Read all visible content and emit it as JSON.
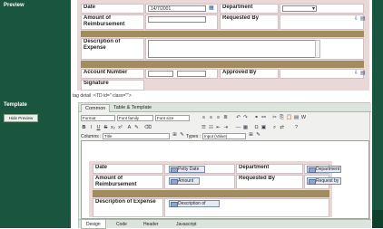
{
  "sidebar": {
    "preview_label": "Preview",
    "template_label": "Template",
    "hide_preview_button": "Hide Preview"
  },
  "preview_form": {
    "date_label": "Date",
    "date_value": "14/7/2001",
    "department_label": "Department",
    "amount_label": "Amount of Reimbursement",
    "requested_by_label": "Requested By",
    "description_label": "Description of Expense",
    "account_number_label": "Account Number",
    "approved_by_label": "Approved By",
    "signature_label": "Signature"
  },
  "tag_detail": "tag detail :<TD id=\" class=\"\">",
  "editor": {
    "tabs": [
      "Common",
      "Table & Template"
    ],
    "format_dropdown": "Format",
    "font_family_dropdown": "Font family",
    "font_size_dropdown": "Font size",
    "columns_label": "Columns :",
    "columns_value": "Title",
    "types_label": "Types :",
    "types_value": "Input (Value)"
  },
  "template_form": {
    "date_label": "Date",
    "date_field": "Petty Date",
    "department_label": "Department",
    "department_field": "Department",
    "amount_label": "Amount of Reimbursement",
    "amount_field": "Amount",
    "requested_by_label": "Requested By",
    "requested_by_field": "Request by",
    "description_label": "Description of Expense",
    "description_field": "Description of"
  },
  "bottom_tabs": [
    "Design",
    "Code",
    "Header",
    "Javascript"
  ],
  "colors": {
    "sidebar_green": "#19553f",
    "form_pink": "#ead7d7",
    "olive_bar": "#a08c5e"
  }
}
